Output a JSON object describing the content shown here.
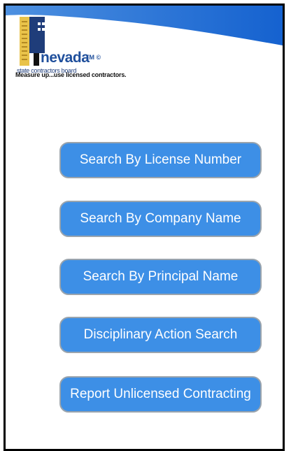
{
  "brand": {
    "name": "nevada",
    "trademark": "TM ©",
    "subtitle": "state contractors board",
    "tagline": "Measure up...use licensed contractors.",
    "colors": {
      "header_blue": "#1f6fd6",
      "button_blue": "#3d8fe6",
      "logo_yellow": "#e9c34a",
      "logo_navy": "#1f3d7a"
    }
  },
  "menu": {
    "items": [
      {
        "label": "Search By License Number"
      },
      {
        "label": "Search By Company Name"
      },
      {
        "label": "Search By Principal Name"
      },
      {
        "label": "Disciplinary Action Search"
      },
      {
        "label": "Report Unlicensed Contracting"
      }
    ]
  }
}
